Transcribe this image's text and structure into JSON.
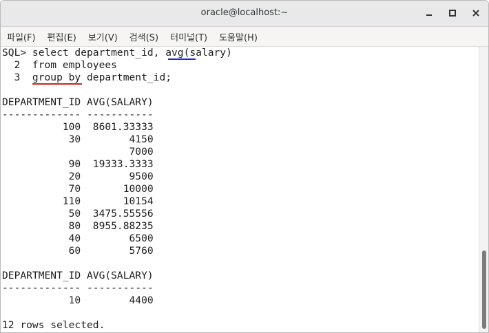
{
  "window": {
    "title": "oracle@localhost:~"
  },
  "menu": [
    "파일(F)",
    "편집(E)",
    "보기(V)",
    "검색(S)",
    "터미널(T)",
    "도움말(H)"
  ],
  "terminal": {
    "lines": [
      "SQL> select department_id, avg(salary)",
      "  2  from employees",
      "  3  group by department_id;",
      "",
      "DEPARTMENT_ID AVG(SALARY)",
      "------------- -----------",
      "          100  8601.33333",
      "           30        4150",
      "                     7000",
      "           90  19333.3333",
      "           20        9500",
      "           70       10000",
      "          110       10154",
      "           50  3475.55556",
      "           80  8955.88235",
      "           40        6500",
      "           60        5760",
      "",
      "DEPARTMENT_ID AVG(SALARY)",
      "------------- -----------",
      "           10        4400",
      "",
      "12 rows selected."
    ]
  },
  "annotations": {
    "underline_avg_color": "#1f2bd6",
    "underline_group_by_color": "#d61f1f"
  },
  "icons": {
    "minimize": "minimize-icon",
    "maximize": "maximize-icon",
    "close": "close-icon"
  }
}
